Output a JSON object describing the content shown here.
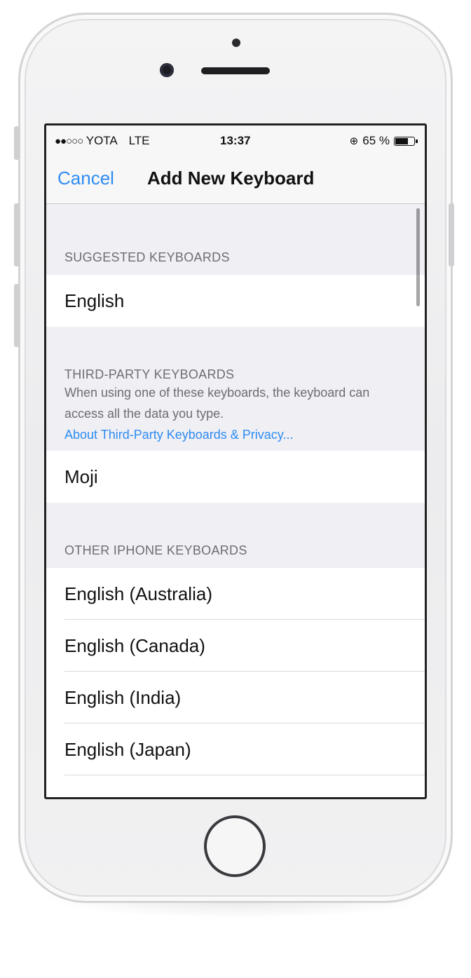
{
  "status_bar": {
    "carrier": "YOTA",
    "network": "LTE",
    "time": "13:37",
    "battery": "65 %",
    "battery_level": 0.65,
    "signal_bars_filled": 2,
    "signal_bars_total": 5
  },
  "nav": {
    "cancel_label": "Cancel",
    "title": "Add New Keyboard"
  },
  "sections": {
    "suggested": {
      "header": "SUGGESTED KEYBOARDS",
      "items": [
        "English"
      ]
    },
    "third_party": {
      "header": "THIRD-PARTY KEYBOARDS",
      "description": "When using one of these keyboards, the keyboard can access all the data you type.",
      "link": "About Third-Party Keyboards & Privacy...",
      "items": [
        "Moji"
      ]
    },
    "other": {
      "header": "OTHER IPHONE KEYBOARDS",
      "items": [
        "English (Australia)",
        "English (Canada)",
        "English (India)",
        "English (Japan)"
      ]
    }
  },
  "colors": {
    "accent": "#2f8cf2",
    "grouped_background": "#efeff4",
    "section_text": "#6d6d72"
  }
}
